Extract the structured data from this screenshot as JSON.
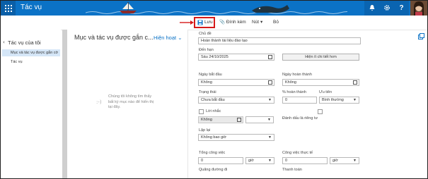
{
  "topbar": {
    "app_title": "Tác vụ",
    "help_label": "?",
    "colors": {
      "brand": "#0b72c6",
      "waffle_bg": "#0a5fa8"
    }
  },
  "toolbar": {
    "save_label": "Lưu",
    "attach_label": "Đính kèm",
    "more_label": "Nút",
    "discard_label": "Bỏ"
  },
  "leftnav": {
    "header": "Tác vụ của tôi",
    "items": [
      {
        "label": "Mục và tác vụ được gắn cờ",
        "selected": true
      },
      {
        "label": "Tác vụ",
        "selected": false
      }
    ]
  },
  "list": {
    "title": "Mục và tác vụ được gắn c...",
    "filter_label": "Hiện hoạt",
    "empty_icon": ":-)",
    "empty_message": "Chúng tôi không tìm thấy bất kỳ mục nào để hiển thị tại đây."
  },
  "form": {
    "subject": {
      "label": "Chủ đề",
      "value": "Hoàn thành tài liệu đào tạo"
    },
    "due_date": {
      "label": "Đến hạn",
      "value": "Sáu 24/10/2025"
    },
    "show_details_button": "Hiện ít chi tiết hơn",
    "start_date": {
      "label": "Ngày bắt đầu",
      "value": "Không"
    },
    "completed_date": {
      "label": "Ngày hoàn thành",
      "value": "Không"
    },
    "status": {
      "label": "Trạng thái",
      "value": "Chưa bắt đầu"
    },
    "percent_complete": {
      "label": "% hoàn thành",
      "value": "0"
    },
    "priority": {
      "label": "Ưu tiên",
      "value": "Bình thường"
    },
    "reminder": {
      "label": "Lời nhắc",
      "checked": false,
      "date_value": "Không",
      "time_value": ""
    },
    "private": {
      "label": "Đánh dấu là riêng tư",
      "checked": false
    },
    "recurrence": {
      "label": "Lặp lại",
      "value": "Không bao giờ"
    },
    "total_work": {
      "label": "Tổng công việc",
      "value": "0",
      "unit": "giờ"
    },
    "actual_work": {
      "label": "Công việc thực tế",
      "value": "0",
      "unit": "giờ"
    },
    "mileage": {
      "label": "Quãng đường đi"
    },
    "billing": {
      "label": "Thanh toán"
    }
  }
}
